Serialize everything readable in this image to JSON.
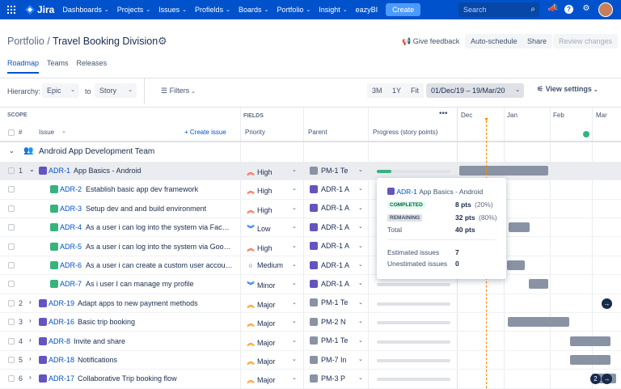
{
  "nav": {
    "app": "Jira",
    "items": [
      "Dashboards",
      "Projects",
      "Issues",
      "Profields",
      "Boards",
      "Portfolio",
      "Insight",
      "eazyBI"
    ],
    "create": "Create",
    "search_placeholder": "Search"
  },
  "header": {
    "breadcrumb": "Portfolio /",
    "title": "Travel Booking Division",
    "feedback": "Give feedback",
    "autoschedule": "Auto-schedule",
    "share": "Share",
    "review": "Review changes"
  },
  "tabs": [
    "Roadmap",
    "Teams",
    "Releases"
  ],
  "toolbar": {
    "hierarchy_label": "Hierarchy:",
    "from": "Epic",
    "to_label": "to",
    "to": "Story",
    "filters": "Filters",
    "zoom": [
      "3M",
      "1Y",
      "Fit"
    ],
    "daterange": "01/Dec/19 – 19/Mar/20",
    "view_settings": "View settings"
  },
  "table_header": {
    "scope": "SCOPE",
    "fields": "FIELDS",
    "num": "#",
    "issue": "Issue",
    "create_issue": "+ Create issue",
    "priority": "Priority",
    "parent": "Parent",
    "progress": "Progress (story points)",
    "months": [
      "Dec",
      "Jan",
      "Feb",
      "Mar"
    ]
  },
  "team": "Android App Development Team",
  "rows": [
    {
      "num": "1",
      "key": "ADR-1",
      "summary": "App Basics - Android",
      "priority": "High",
      "parent": "PM-1 Te",
      "type": "epic"
    },
    {
      "num": "",
      "key": "ADR-2",
      "summary": "Establish basic app dev framework",
      "priority": "High",
      "parent": "ADR-1 A",
      "type": "story"
    },
    {
      "num": "",
      "key": "ADR-3",
      "summary": "Setup dev and and build environment",
      "priority": "High",
      "parent": "ADR-1 A",
      "type": "story"
    },
    {
      "num": "",
      "key": "ADR-4",
      "summary": "As a user i can log into the system via Facebook",
      "priority": "Low",
      "parent": "ADR-1 A",
      "type": "story"
    },
    {
      "num": "",
      "key": "ADR-5",
      "summary": "As a user i can log into the system via Google",
      "priority": "High",
      "parent": "ADR-1 A",
      "type": "story"
    },
    {
      "num": "",
      "key": "ADR-6",
      "summary": "As a user i can create a custom user account a...",
      "priority": "Medium",
      "parent": "ADR-1 A",
      "type": "story"
    },
    {
      "num": "",
      "key": "ADR-7",
      "summary": "As i user I can manage my profile",
      "priority": "Minor",
      "parent": "ADR-1 A",
      "type": "story"
    },
    {
      "num": "2",
      "key": "ADR-19",
      "summary": "Adapt apps to new payment methods",
      "priority": "Major",
      "parent": "PM-1 Te",
      "type": "epic"
    },
    {
      "num": "3",
      "key": "ADR-16",
      "summary": "Basic trip booking",
      "priority": "Major",
      "parent": "PM-2 N",
      "type": "epic"
    },
    {
      "num": "4",
      "key": "ADR-8",
      "summary": "Invite and share",
      "priority": "Major",
      "parent": "PM-1 Te",
      "type": "epic"
    },
    {
      "num": "5",
      "key": "ADR-18",
      "summary": "Notifications",
      "priority": "Major",
      "parent": "PM-7 In",
      "type": "epic"
    },
    {
      "num": "6",
      "key": "ADR-17",
      "summary": "Collaborative Trip booking flow",
      "priority": "Major",
      "parent": "PM-3 P",
      "type": "epic"
    }
  ],
  "tooltip": {
    "key": "ADR-1",
    "title": "App Basics - Android",
    "completed_label": "COMPLETED",
    "completed_value": "8 pts",
    "completed_pct": "(20%)",
    "remaining_label": "REMAINING",
    "remaining_value": "32 pts",
    "remaining_pct": "(80%)",
    "total_label": "Total",
    "total_value": "40 pts",
    "estimated_label": "Estimated issues",
    "estimated_value": "7",
    "unestimated_label": "Unestimated issues",
    "unestimated_value": "0"
  },
  "timeline_badge": "2",
  "colors": {
    "primary": "#0052cc",
    "epic": "#6554c0",
    "story": "#36b37e",
    "bar": "#8993a4",
    "today": "#ff8b00"
  }
}
